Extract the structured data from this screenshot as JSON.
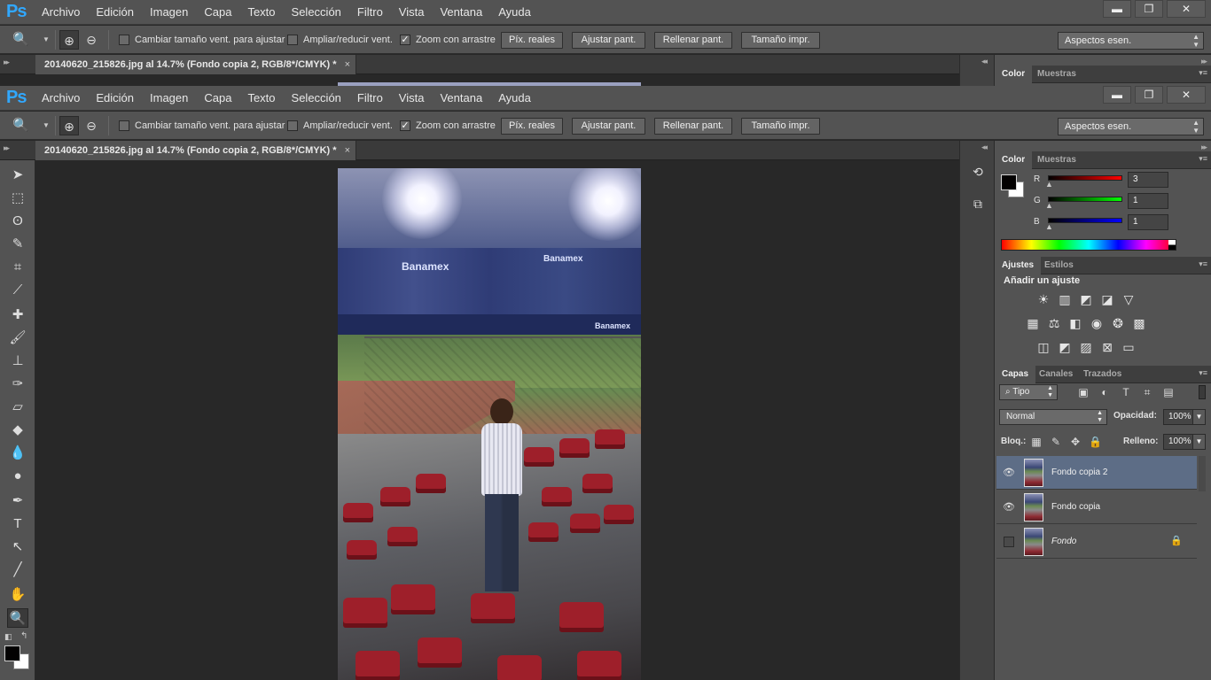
{
  "app": {
    "logo": "Ps",
    "menu": [
      "Archivo",
      "Edición",
      "Imagen",
      "Capa",
      "Texto",
      "Selección",
      "Filtro",
      "Vista",
      "Ventana",
      "Ayuda"
    ],
    "window_buttons": {
      "minimize": "▬",
      "restore": "❐",
      "close": "✕"
    }
  },
  "options": {
    "resize_window": "Cambiar tamaño vent. para ajustar",
    "zoom_all": "Ampliar/reducir vent.",
    "scrubby_zoom": "Zoom con arrastre",
    "actual_pixels": "Píx. reales",
    "fit_screen": "Ajustar pant.",
    "fill_screen": "Rellenar pant.",
    "print_size": "Tamaño impr.",
    "workspace": "Aspectos esen."
  },
  "document": {
    "tab_title": "20140620_215826.jpg al 14.7% (Fondo copia 2, RGB/8*/CMYK) *",
    "close": "×"
  },
  "photo": {
    "board_text": [
      "Banamex",
      "Banamex",
      "Banamex"
    ]
  },
  "panels": {
    "color_tabs": [
      "Color",
      "Muestras"
    ],
    "color": {
      "foreground": "#030101",
      "background": "#ffffff",
      "channels": [
        {
          "label": "R",
          "value": "3"
        },
        {
          "label": "G",
          "value": "1"
        },
        {
          "label": "B",
          "value": "1"
        }
      ]
    },
    "adjust_tabs": [
      "Ajustes",
      "Estilos"
    ],
    "adjust_title": "Añadir un ajuste",
    "layer_tabs": [
      "Capas",
      "Canales",
      "Trazados"
    ],
    "layers_filter": "Tipo",
    "blend_mode": "Normal",
    "opacity_label": "Opacidad:",
    "opacity_value": "100%",
    "lock_label": "Bloq.:",
    "fill_label": "Relleno:",
    "fill_value": "100%",
    "layers": [
      {
        "name": "Fondo copia 2",
        "visible": true,
        "selected": true
      },
      {
        "name": "Fondo copia",
        "visible": true,
        "selected": false
      },
      {
        "name": "Fondo",
        "visible": false,
        "selected": false,
        "locked": true
      }
    ]
  }
}
